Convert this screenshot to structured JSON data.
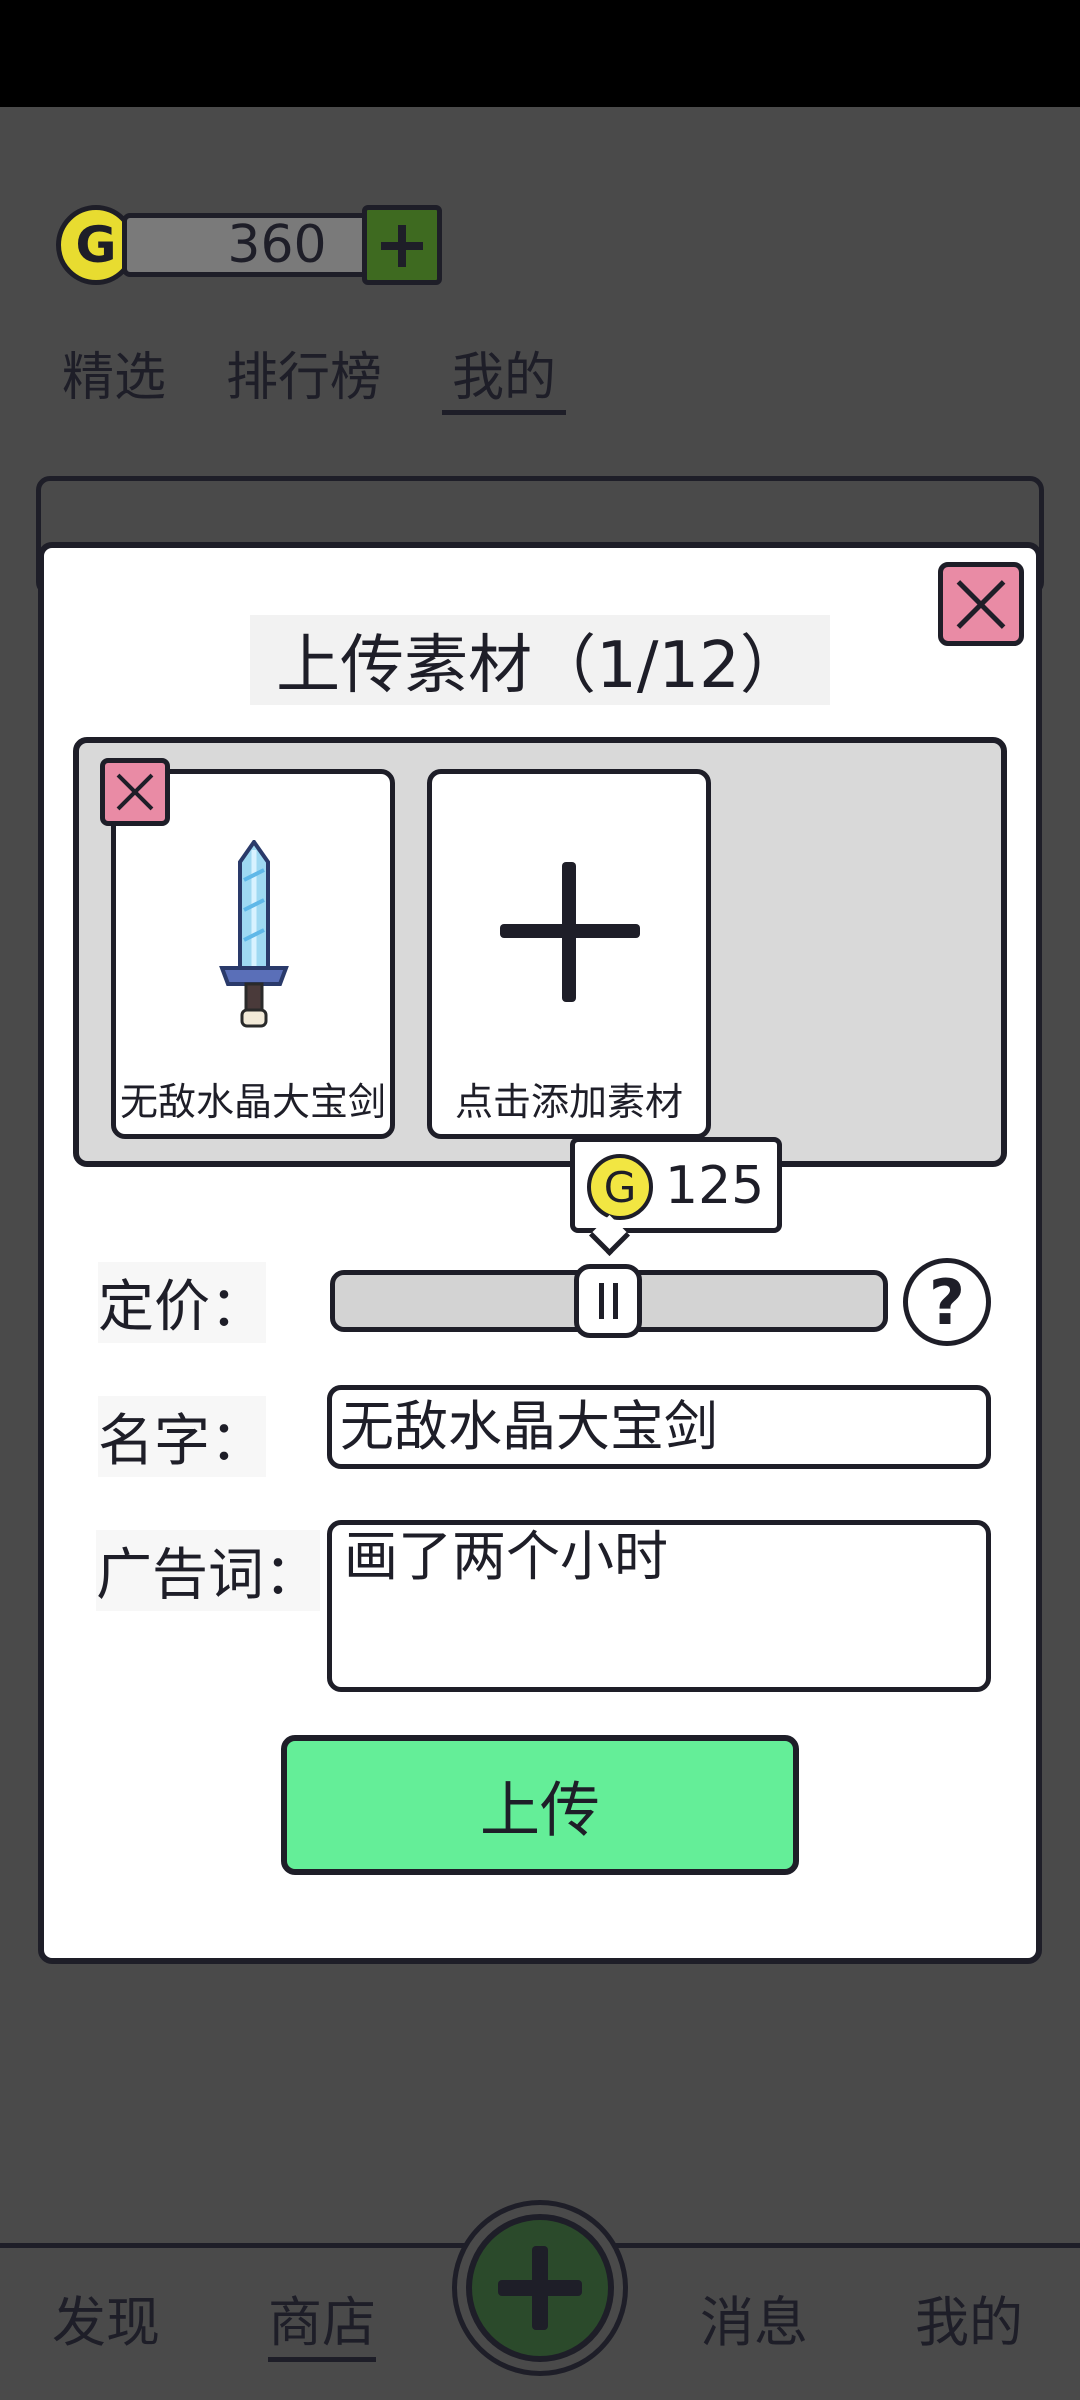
{
  "header": {
    "coin_symbol": "G",
    "coins": "360"
  },
  "top_tabs": [
    {
      "label": "精选"
    },
    {
      "label": "排行榜"
    },
    {
      "label": "我的",
      "active": true
    }
  ],
  "bottom_nav": [
    {
      "label": "发现"
    },
    {
      "label": "商店",
      "active": true
    },
    {
      "label": "消息"
    },
    {
      "label": "我的"
    }
  ],
  "modal": {
    "title": "上传素材（1/12）",
    "materials": [
      {
        "label": "无敌水晶大宝剑",
        "icon": "pixel-sword-icon"
      },
      {
        "label": "点击添加素材",
        "icon": "plus-icon"
      }
    ],
    "price": {
      "label": "定价：",
      "coin_symbol": "G",
      "value": "125",
      "help_symbol": "?"
    },
    "name": {
      "label": "名字：",
      "value": "无敌水晶大宝剑"
    },
    "ad": {
      "label": "广告词：",
      "value": "画了两个小时"
    },
    "upload_label": "上传"
  },
  "colors": {
    "overlay": "#4a4a4a",
    "ink": "#1e1e28",
    "coin": "#f2e642",
    "close": "#e98ba5",
    "upload": "#64ee98",
    "panel": "#d9d9d9"
  }
}
